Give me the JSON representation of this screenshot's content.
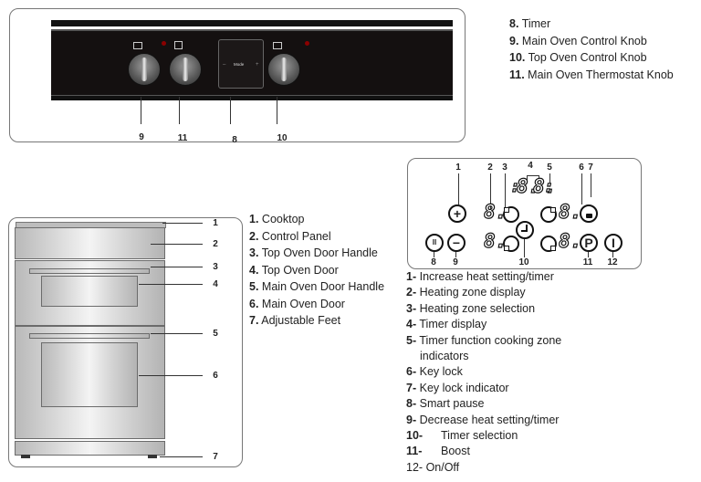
{
  "control_panel_figure": {
    "callouts": [
      "9",
      "11",
      "8",
      "10"
    ],
    "timer_label": "Mode",
    "legend": [
      {
        "num": "8.",
        "text": "Timer"
      },
      {
        "num": "9.",
        "text": "Main Oven Control Knob"
      },
      {
        "num": "10.",
        "text": "Top Oven Control Knob"
      },
      {
        "num": "11.",
        "text": "Main Oven Thermostat Knob"
      }
    ]
  },
  "oven_figure": {
    "callouts": [
      "1",
      "2",
      "3",
      "4",
      "5",
      "6",
      "7"
    ],
    "legend": [
      {
        "num": "1.",
        "text": "Cooktop"
      },
      {
        "num": "2.",
        "text": "Control Panel"
      },
      {
        "num": "3.",
        "text": "Top Oven Door Handle"
      },
      {
        "num": "4.",
        "text": "Top Oven Door"
      },
      {
        "num": "5.",
        "text": "Main Oven Door Handle"
      },
      {
        "num": "6.",
        "text": "Main Oven Door"
      },
      {
        "num": "7.",
        "text": "Adjustable Feet"
      }
    ]
  },
  "cooktop_figure": {
    "callouts": {
      "c1": "1",
      "c2": "2",
      "c3": "3",
      "c4": "4",
      "c5": "5",
      "c6": "6",
      "c7": "7",
      "c8": "8",
      "c9": "9",
      "c10": "10",
      "c11": "11",
      "c12": "12"
    },
    "buttons": {
      "plus": "+",
      "minus": "−",
      "pause": "II",
      "boost": "P",
      "onoff": "I"
    },
    "digits": {
      "zone": "8.",
      "timer_left": "8.",
      "timer_right": "8.",
      "colon_left": ":",
      "colon_right": ":"
    },
    "legend": [
      {
        "num": "1-",
        "text": "Increase heat setting/timer"
      },
      {
        "num": "2-",
        "text": "Heating zone display"
      },
      {
        "num": "3-",
        "text": "Heating zone selection"
      },
      {
        "num": "4-",
        "text": "Timer display"
      },
      {
        "num": "5-",
        "text": "Timer function cooking zone"
      },
      {
        "num": "",
        "text": "indicators"
      },
      {
        "num": "6-",
        "text": "Key lock"
      },
      {
        "num": "7-",
        "text": "Key lock indicator"
      },
      {
        "num": "8-",
        "text": "Smart pause"
      },
      {
        "num": "9-",
        "text": "Decrease heat setting/timer"
      },
      {
        "num": "10-",
        "text": "Timer selection"
      },
      {
        "num": "11-",
        "text": "Boost"
      },
      {
        "num": "12-",
        "text": "On/Off"
      }
    ]
  }
}
